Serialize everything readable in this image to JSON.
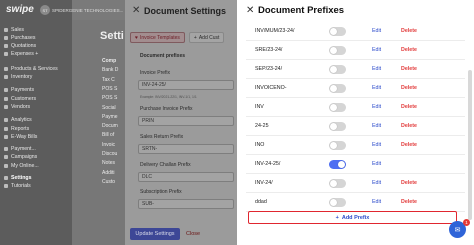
{
  "app": {
    "logo": "swipe",
    "company_initials": "ST",
    "company_name": "SPIDERGENIE TECHNOLOGIES..."
  },
  "sidebar": {
    "items": [
      {
        "label": "Sales",
        "icon": "sales-icon"
      },
      {
        "label": "Purchases",
        "icon": "purchases-icon"
      },
      {
        "label": "Quotations",
        "icon": "quotations-icon"
      },
      {
        "label": "Expenses +",
        "icon": "expenses-icon"
      },
      {
        "label": "Products & Services",
        "icon": "products-icon"
      },
      {
        "label": "Inventory",
        "icon": "inventory-icon"
      },
      {
        "label": "Payments",
        "icon": "payments-icon"
      },
      {
        "label": "Customers",
        "icon": "customers-icon"
      },
      {
        "label": "Vendors",
        "icon": "vendors-icon"
      },
      {
        "label": "Analytics",
        "icon": "analytics-icon"
      },
      {
        "label": "Reports",
        "icon": "reports-icon"
      },
      {
        "label": "E-Way Bills",
        "icon": "eway-icon"
      },
      {
        "label": "Payment...",
        "icon": "payment-link-icon"
      },
      {
        "label": "Campaigns",
        "icon": "campaigns-icon"
      },
      {
        "label": "My Online...",
        "icon": "store-icon"
      },
      {
        "label": "Settings",
        "icon": "settings-icon"
      },
      {
        "label": "Tutorials",
        "icon": "tutorials-icon"
      }
    ]
  },
  "settings_column": {
    "title": "Setti",
    "items": [
      "Comp",
      "Bank D",
      "Tax C",
      "POS S",
      "POS S",
      "Social",
      "Payme",
      "Docum",
      "Bill of",
      "Invoic",
      "Discou",
      "Notes",
      "Additi",
      "Custo"
    ]
  },
  "document_settings": {
    "title": "Document Settings",
    "tab_invoice_templates": "Invoice Templates",
    "tab_add_custom": "Add Cust",
    "section_label": "Document prefixes",
    "fields": [
      {
        "label": "Invoice Prefix",
        "value": "INV-24-25/"
      },
      {
        "label": "Purchase Invoice Prefix",
        "value": "PRIN"
      },
      {
        "label": "Sales Return Prefix",
        "value": "SRTN-"
      },
      {
        "label": "Delivery Challan Prefix",
        "value": "DLC"
      },
      {
        "label": "Subscription Prefix",
        "value": "SUB-"
      }
    ],
    "help_text": "Example: INV/2021-22/1, INV-1/1, 1/1",
    "update_button": "Update Settings",
    "close_button": "Close"
  },
  "document_prefixes": {
    "title": "Document Prefixes",
    "edit_label": "Edit",
    "delete_label": "Delete",
    "rows": [
      {
        "name": "INV/MUM/23-24/",
        "enabled": false,
        "deletable": true
      },
      {
        "name": "SRE/23-24/",
        "enabled": false,
        "deletable": true
      },
      {
        "name": "SEP/23-24/",
        "enabled": false,
        "deletable": true
      },
      {
        "name": "INVOICENO-",
        "enabled": false,
        "deletable": true
      },
      {
        "name": "INV",
        "enabled": false,
        "deletable": true
      },
      {
        "name": "24-25",
        "enabled": false,
        "deletable": true
      },
      {
        "name": "INO",
        "enabled": false,
        "deletable": true
      },
      {
        "name": "INV-24-25/",
        "enabled": true,
        "deletable": false
      },
      {
        "name": "INV-24/",
        "enabled": false,
        "deletable": true
      },
      {
        "name": "ddad",
        "enabled": false,
        "deletable": true
      }
    ],
    "add_button": "Add Prefix"
  },
  "chat": {
    "badge": "1"
  },
  "colors": {
    "accent": "#2b4acb",
    "danger": "#e23b3b",
    "toggle_on": "#4e6ef2"
  }
}
